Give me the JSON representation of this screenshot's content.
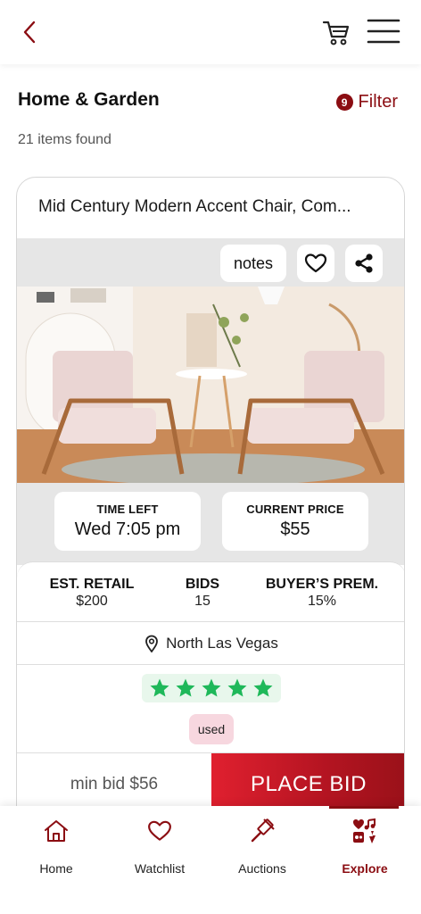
{
  "header": {
    "back_icon": "chevron-left-icon",
    "cart_icon": "cart-icon",
    "menu_icon": "hamburger-menu-icon"
  },
  "category": {
    "title": "Home & Garden",
    "filter_count": "9",
    "filter_label": "Filter",
    "items_found": "21 items found"
  },
  "listing": {
    "title": "Mid Century Modern Accent Chair, Com...",
    "notes_label": "notes",
    "time_left_label": "TIME LEFT",
    "time_left_value": "Wed 7:05 pm",
    "current_price_label": "CURRENT PRICE",
    "current_price_value": "$55",
    "est_retail_label": "EST. RETAIL",
    "est_retail_value": "$200",
    "bids_label": "BIDS",
    "bids_value": "15",
    "buyers_prem_label": "BUYER’S PREM.",
    "buyers_prem_value": "15%",
    "location": "North Las Vegas",
    "rating": 5,
    "condition": "used",
    "min_bid": "min bid $56",
    "place_bid_label": "PLACE BID"
  },
  "nav": {
    "items": [
      {
        "label": "Home",
        "icon": "home-icon"
      },
      {
        "label": "Watchlist",
        "icon": "heart-icon"
      },
      {
        "label": "Auctions",
        "icon": "gavel-icon"
      },
      {
        "label": "Explore",
        "icon": "explore-icon"
      }
    ],
    "active": "Explore"
  },
  "colors": {
    "brand": "#8b0d12",
    "bid_button": "#d11a2a",
    "star_green": "#1fb85a",
    "star_badge_bg": "#e8f7ec",
    "condition_bg": "#f7d7df",
    "band_gray": "#e6e6e6"
  }
}
